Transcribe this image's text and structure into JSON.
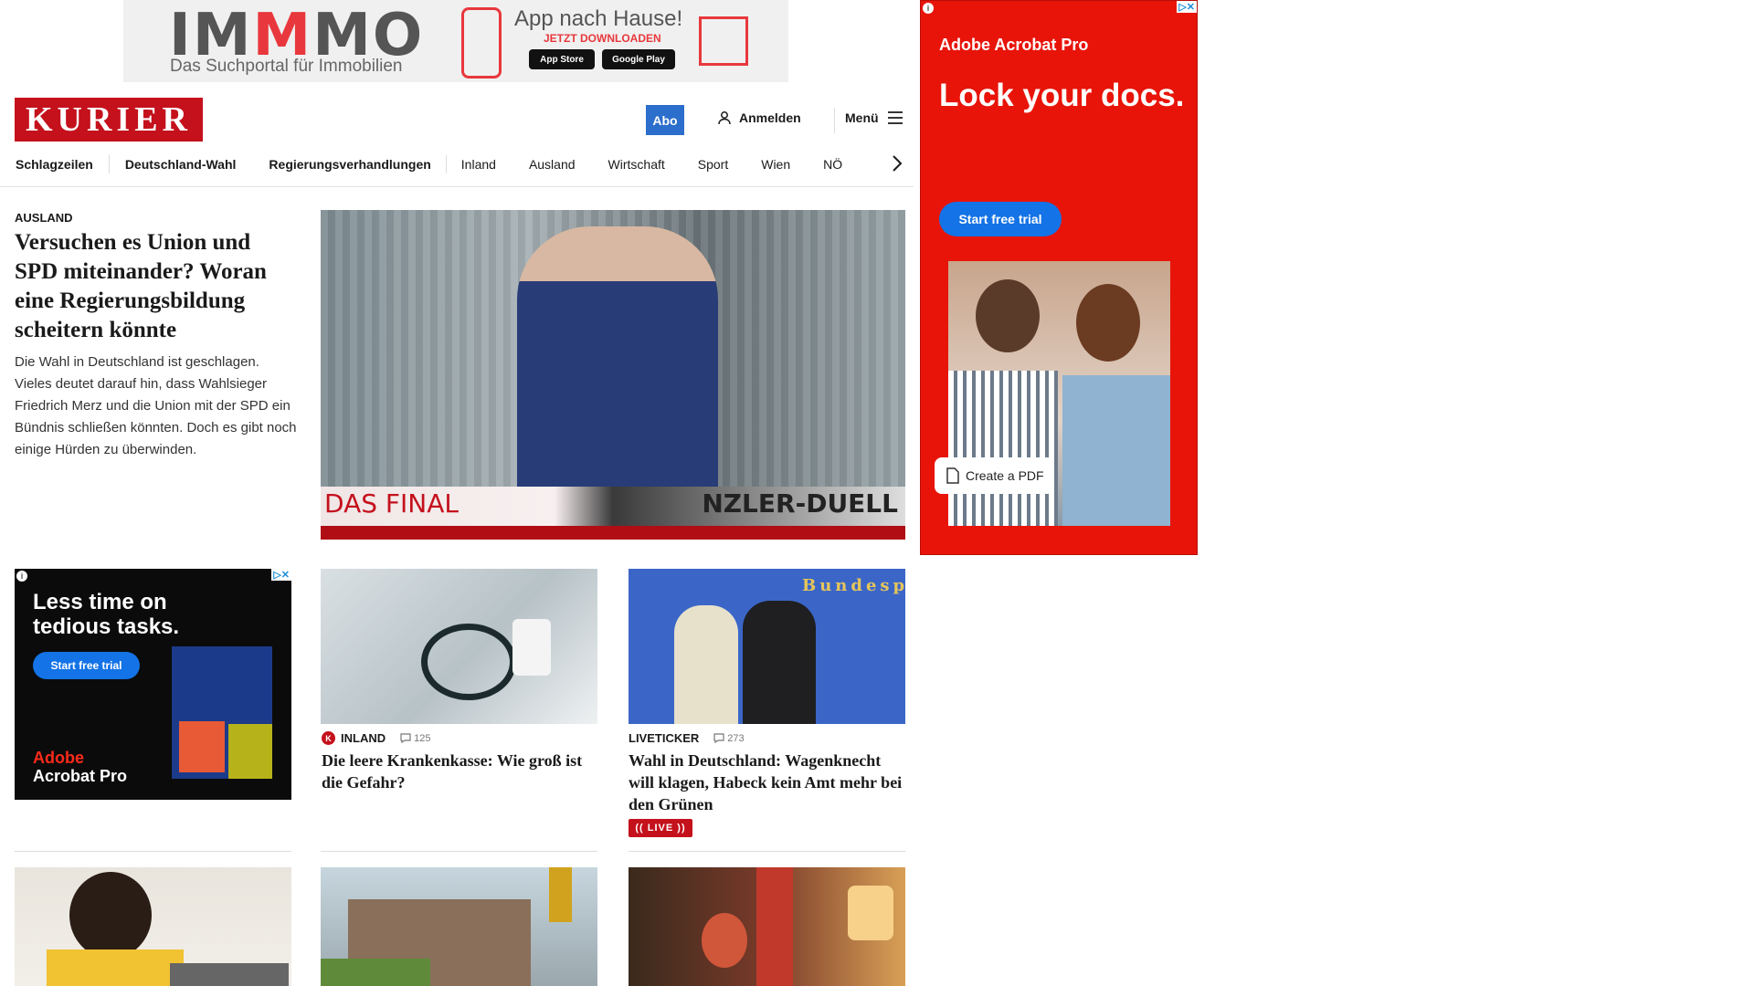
{
  "banner_ad": {
    "brand": "IMMMO",
    "brand_pre": "IM",
    "brand_mid": "M",
    "brand_post": "MO",
    "tagline": "Das Suchportal für Immobilien",
    "app_title": "App nach Hause!",
    "download_label": "JETZT DOWNLOADEN",
    "app_store": "App Store",
    "google_play": "Google Play"
  },
  "header": {
    "logo": "KURIER",
    "abo_label": "Abo",
    "login_label": "Anmelden",
    "menu_label": "Menü"
  },
  "nav": {
    "items": [
      "Schlagzeilen",
      "Deutschland-Wahl",
      "Regierungsverhandlungen",
      "Inland",
      "Ausland",
      "Wirtschaft",
      "Sport",
      "Wien",
      "NÖ"
    ]
  },
  "lead": {
    "kicker": "AUSLAND",
    "title": "Versuchen es Union und SPD miteinander? Woran eine Regierungsbildung scheitern könnte",
    "teaser": "Die Wahl in Deutschland ist geschlagen. Vieles deutet darauf hin, dass Wahlsieger Friedrich Merz und die Union mit der SPD ein Bündnis schließen könnten. Doch es gibt noch einige Hürden zu überwinden.",
    "image_caption_left": "DAS FINAL",
    "image_caption_right": "NZLER-DUELL"
  },
  "right_ad": {
    "brand": "Adobe Acrobat Pro",
    "headline": "Lock your docs.",
    "cta": "Start free trial",
    "pdf_button": "Create a PDF"
  },
  "left_ad": {
    "headline": "Less time on tedious tasks.",
    "cta": "Start free trial",
    "brand_adobe": "Adobe",
    "brand_product": "Acrobat Pro"
  },
  "cards": [
    {
      "kicker": "INLAND",
      "comments": "125",
      "title": "Die leere Krankenkasse: Wie groß ist die Gefahr?"
    },
    {
      "kicker": "LIVETICKER",
      "comments": "273",
      "title": "Wahl in Deutschland: Wagenknecht will klagen, Habeck kein Amt mehr bei den Grünen",
      "live_label": "(( LIVE ))"
    }
  ],
  "image_texts": {
    "bundes": "Bundesp"
  },
  "colors": {
    "brand_red": "#c4111c",
    "abo_blue": "#2c6ecb",
    "ad_red": "#e81409",
    "adobe_blue": "#1473e6"
  }
}
